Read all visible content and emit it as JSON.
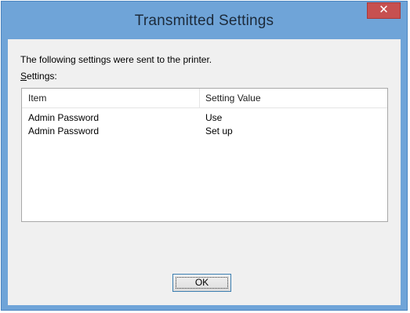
{
  "window": {
    "title": "Transmitted Settings",
    "close_symbol": "✕"
  },
  "dialog": {
    "message": "The following settings were sent to the printer.",
    "settings_label_accel": "S",
    "settings_label_rest": "ettings:"
  },
  "table": {
    "columns": [
      "Item",
      "Setting Value"
    ],
    "rows": [
      {
        "item": "Admin Password",
        "value": "Use"
      },
      {
        "item": "Admin Password",
        "value": "Set up"
      }
    ]
  },
  "buttons": {
    "ok_label": "OK"
  },
  "colors": {
    "titlebar": "#6fa4d8",
    "client": "#f0f0f0",
    "close": "#c75050"
  },
  "icons": {
    "close": "close-icon"
  }
}
